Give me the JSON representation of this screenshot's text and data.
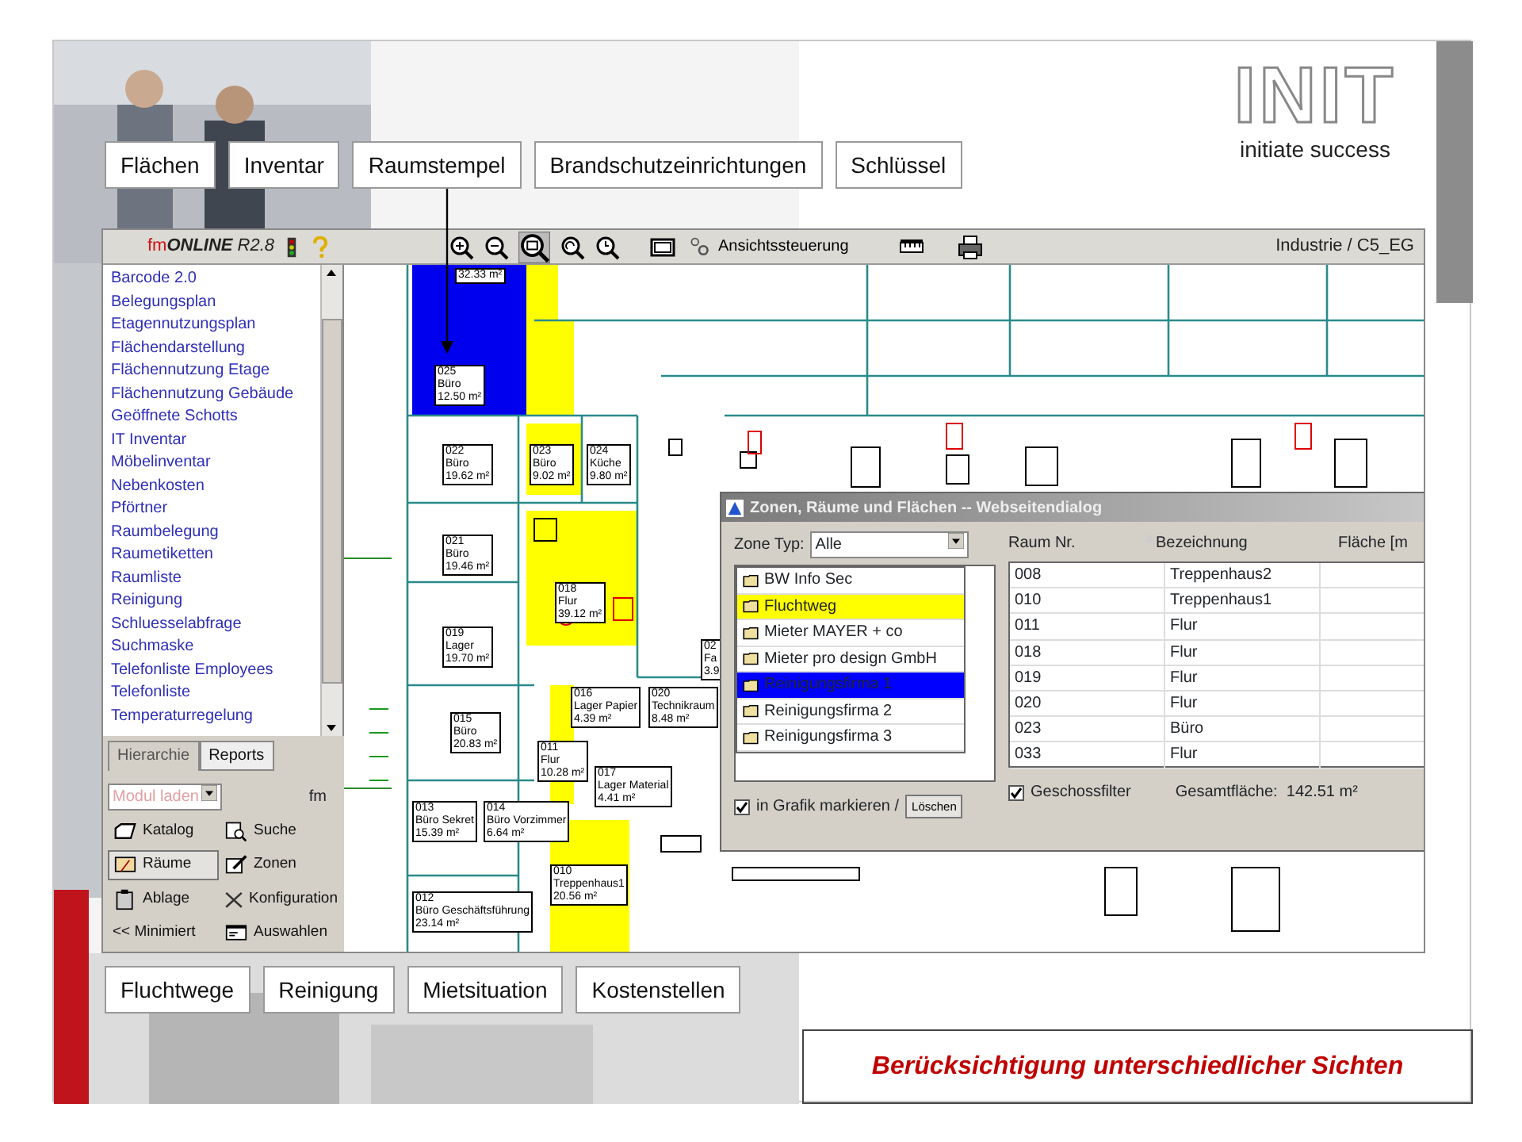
{
  "logo": {
    "wordmark": "INIT",
    "slogan": "initiate success"
  },
  "top_buttons": [
    "Flächen",
    "Inventar",
    "Raumstempel",
    "Brandschutzeinrichtungen",
    "Schlüssel"
  ],
  "app": {
    "brand": {
      "prefix": "fm",
      "name": "ONLINE",
      "version": "R2.8"
    },
    "toolbar": {
      "view_control": "Ansichtssteuerung",
      "location": "Industrie / C5_EG"
    },
    "sidebar": {
      "items": [
        "Barcode 2.0",
        "Belegungsplan",
        "Etagennutzungsplan",
        "Flächendarstellung",
        "Flächennutzung Etage",
        "Flächennutzung Gebäude",
        "Geöffnete Schotts",
        "IT Inventar",
        "Möbelinventar",
        "Nebenkosten",
        "Pförtner",
        "Raumbelegung",
        "Raumetiketten",
        "Raumliste",
        "Reinigung",
        "Schluesselabfrage",
        "Suchmaske",
        "Telefonliste Employees",
        "Telefonliste",
        "Temperaturregelung"
      ],
      "tabs": [
        {
          "label": "Hierarchie",
          "selected": true
        },
        {
          "label": "Reports",
          "selected": false
        }
      ],
      "module_select": {
        "value": "Modul laden",
        "disabled": true
      },
      "fm_label": "fm",
      "tools": [
        {
          "label": "Katalog",
          "selected": false
        },
        {
          "label": "Suche",
          "selected": false
        },
        {
          "label": "Räume",
          "selected": true
        },
        {
          "label": "Zonen",
          "selected": false
        },
        {
          "label": "Ablage",
          "selected": false
        },
        {
          "label": "Konfiguration",
          "selected": false
        },
        {
          "label": "<< Minimiert",
          "selected": false
        },
        {
          "label": "Auswahlen",
          "selected": false
        }
      ]
    },
    "rooms": [
      {
        "lines": [
          "32.33 m²"
        ]
      },
      {
        "lines": [
          "025",
          "Büro",
          "12.50 m²"
        ]
      },
      {
        "lines": [
          "022",
          "Büro",
          "19.62 m²"
        ]
      },
      {
        "lines": [
          "023",
          "Büro",
          "9.02 m²"
        ]
      },
      {
        "lines": [
          "024",
          "Küche",
          "9.80 m²"
        ]
      },
      {
        "lines": [
          "021",
          "Büro",
          "19.46 m²"
        ]
      },
      {
        "lines": [
          "018",
          "Flur",
          "39.12 m²"
        ]
      },
      {
        "lines": [
          "019",
          "Lager",
          "19.70 m²"
        ]
      },
      {
        "lines": [
          "02",
          "Fa",
          "3.9"
        ]
      },
      {
        "lines": [
          "015",
          "Büro",
          "20.83 m²"
        ]
      },
      {
        "lines": [
          "016",
          "Lager Papier",
          "4.39 m²"
        ]
      },
      {
        "lines": [
          "020",
          "Technikraum",
          "8.48 m²"
        ]
      },
      {
        "lines": [
          "011",
          "Flur",
          "10.28 m²"
        ]
      },
      {
        "lines": [
          "017",
          "Lager Material",
          "4.41 m²"
        ]
      },
      {
        "lines": [
          "013",
          "Büro Sekret",
          "15.39 m²"
        ]
      },
      {
        "lines": [
          "014",
          "Büro Vorzimmer",
          "6.64 m²"
        ]
      },
      {
        "lines": [
          "010",
          "Treppenhaus1",
          "20.56 m²"
        ]
      },
      {
        "lines": [
          "012",
          "Büro Geschäftsführung",
          "23.14 m²"
        ]
      }
    ],
    "dialog": {
      "title": "Zonen, Räume und Flächen -- Webseitendialog",
      "zone_type_label": "Zone Typ:",
      "zone_type_value": "Alle",
      "zones": [
        {
          "label": "BW Info Sec",
          "color": "#ffffff"
        },
        {
          "label": "Fluchtweg",
          "color": "#ffff00"
        },
        {
          "label": "Mieter MAYER + co",
          "color": "#ffffff"
        },
        {
          "label": "Mieter pro design GmbH",
          "color": "#ffffff"
        },
        {
          "label": "Reinigungsfirma 1",
          "color": "#0000ff"
        },
        {
          "label": "Reinigungsfirma 2",
          "color": "#ffffff"
        },
        {
          "label": "Reinigungsfirma 3",
          "color": "#ffffff"
        }
      ],
      "columns": [
        "Raum Nr.",
        "Bezeichnung",
        "Fläche [m"
      ],
      "rows": [
        [
          "008",
          "Treppenhaus2"
        ],
        [
          "010",
          "Treppenhaus1"
        ],
        [
          "011",
          "Flur"
        ],
        [
          "018",
          "Flur"
        ],
        [
          "019",
          "Flur"
        ],
        [
          "020",
          "Flur"
        ],
        [
          "023",
          "Büro"
        ],
        [
          "033",
          "Flur"
        ]
      ],
      "mark_in_graphic": {
        "label": "in Grafik markieren /",
        "checked": true
      },
      "clear_button": "Löschen",
      "floor_filter": {
        "label": "Geschossfilter",
        "checked": true
      },
      "total": "Gesamtfläche:  142.51 m²"
    }
  },
  "bottom_buttons": [
    "Fluchtwege",
    "Reinigung",
    "Mietsituation",
    "Kostenstellen"
  ],
  "caption": "Berücksichtigung unterschiedlicher Sichten"
}
